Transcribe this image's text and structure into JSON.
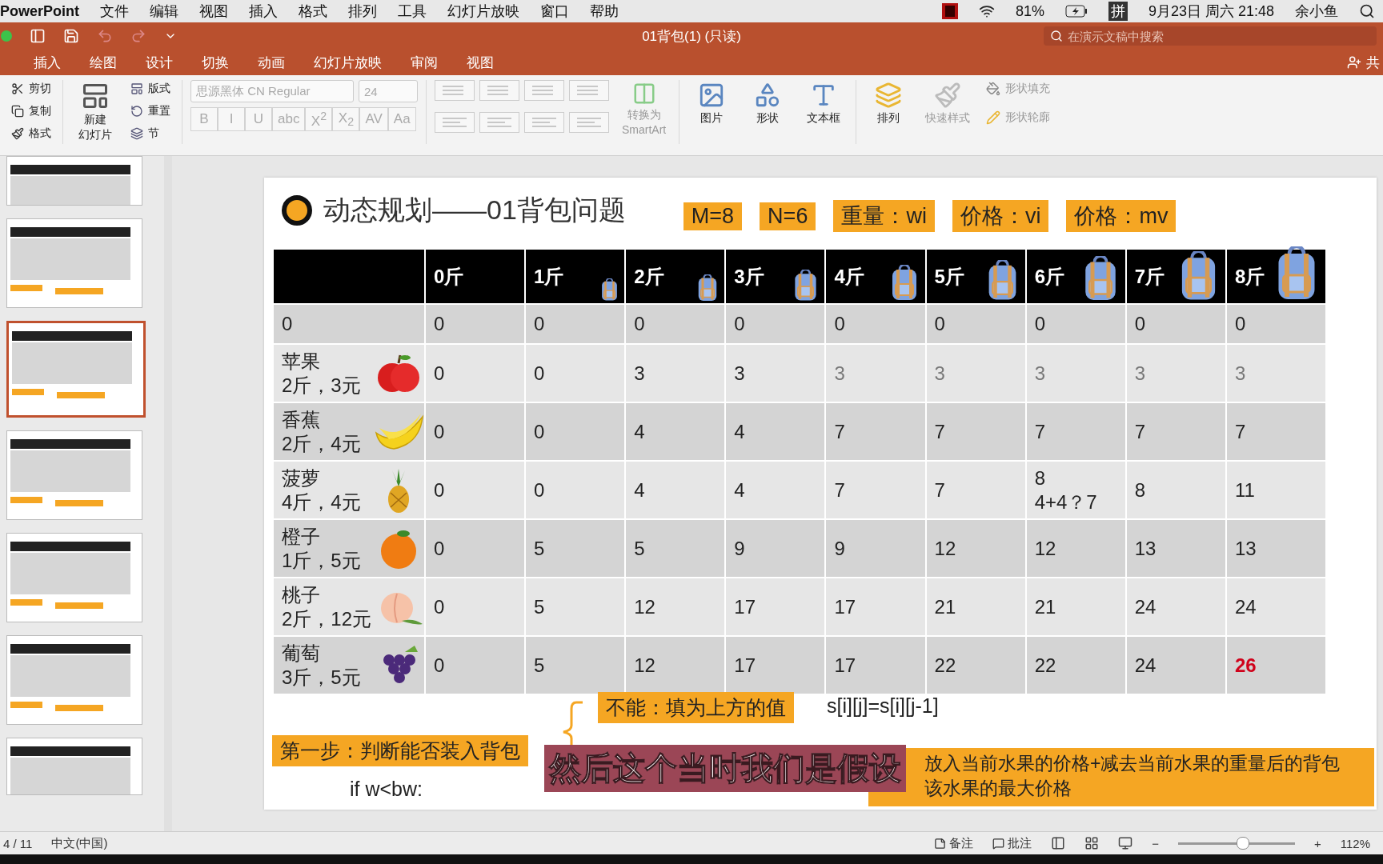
{
  "menu_bar": {
    "app": "PowerPoint",
    "items": [
      "文件",
      "编辑",
      "视图",
      "插入",
      "格式",
      "排列",
      "工具",
      "幻灯片放映",
      "窗口",
      "帮助"
    ],
    "battery": "81%",
    "input_method": "拼",
    "clock": "9月23日 周六 21:48",
    "user": "余小鱼"
  },
  "title_bar": {
    "title": "01背包(1) (只读)",
    "search": {
      "placeholder": "在演示文稿中搜索"
    },
    "share": "共"
  },
  "ribbon_tabs": [
    "插入",
    "绘图",
    "设计",
    "切换",
    "动画",
    "幻灯片放映",
    "审阅",
    "视图"
  ],
  "ribbon": {
    "clipboard": [
      "剪切",
      "复制",
      "格式"
    ],
    "new_slide": [
      "新建",
      "幻灯片"
    ],
    "slide_tools": [
      "版式",
      "重置",
      "节"
    ],
    "font_name": "思源黑体 CN Regular",
    "font_size": "24",
    "format_buttons": [
      "B",
      "I",
      "U",
      "abc",
      "X$^{2}$",
      "X$_{2}$",
      "AV",
      "Aa"
    ],
    "smartart": [
      "转换为",
      "SmartArt"
    ],
    "insert": [
      "图片",
      "形状",
      "文本框"
    ],
    "arrange": "排列",
    "quick_styles": "快速样式",
    "shape_fill": "形状填充",
    "shape_outline": "形状轮廓"
  },
  "slides": [
    {
      "selected": false
    },
    {
      "selected": false
    },
    {
      "selected": true
    },
    {
      "selected": false
    },
    {
      "selected": false
    },
    {
      "selected": false
    },
    {
      "selected": false
    }
  ],
  "slide": {
    "title": "动态规划——01背包问题",
    "tags": [
      "M=8",
      "N=6",
      "重量：wi",
      "价格：vi",
      "价格：mv"
    ],
    "table": {
      "columns": [
        "0斤",
        "1斤",
        "2斤",
        "3斤",
        "4斤",
        "5斤",
        "6斤",
        "7斤",
        "8斤"
      ],
      "rows": [
        {
          "label": [
            "0"
          ],
          "cells": [
            {
              "text": "0",
              "kind": "normal"
            },
            {
              "text": "0",
              "kind": "normal"
            },
            {
              "text": "0",
              "kind": "normal"
            },
            {
              "text": "0",
              "kind": "normal"
            },
            {
              "text": "0",
              "kind": "normal"
            },
            {
              "text": "0",
              "kind": "normal"
            },
            {
              "text": "0",
              "kind": "normal"
            },
            {
              "text": "0",
              "kind": "normal"
            },
            {
              "text": "0",
              "kind": "normal"
            }
          ]
        },
        {
          "label": [
            "苹果",
            "2斤，3元"
          ],
          "cells": [
            {
              "text": "0",
              "kind": "normal"
            },
            {
              "text": "0",
              "kind": "normal"
            },
            {
              "text": "3",
              "kind": "normal"
            },
            {
              "text": "3",
              "kind": "normal"
            },
            {
              "text": "3",
              "kind": "faded"
            },
            {
              "text": "3",
              "kind": "faded"
            },
            {
              "text": "3",
              "kind": "faded"
            },
            {
              "text": "3",
              "kind": "faded"
            },
            {
              "text": "3",
              "kind": "faded"
            }
          ]
        },
        {
          "label": [
            "香蕉",
            "2斤，4元"
          ],
          "cells": [
            {
              "text": "0",
              "kind": "normal"
            },
            {
              "text": "0",
              "kind": "normal"
            },
            {
              "text": "4",
              "kind": "normal"
            },
            {
              "text": "4",
              "kind": "normal"
            },
            {
              "text": "7",
              "kind": "normal"
            },
            {
              "text": "7",
              "kind": "normal"
            },
            {
              "text": "7",
              "kind": "normal"
            },
            {
              "text": "7",
              "kind": "normal"
            },
            {
              "text": "7",
              "kind": "normal"
            }
          ]
        },
        {
          "label": [
            "菠萝",
            "4斤，4元"
          ],
          "cells": [
            {
              "text": "0",
              "kind": "normal"
            },
            {
              "text": "0",
              "kind": "normal"
            },
            {
              "text": "4",
              "kind": "normal"
            },
            {
              "text": "4",
              "kind": "normal"
            },
            {
              "text": "7",
              "kind": "normal"
            },
            {
              "text": "7",
              "kind": "normal"
            },
            {
              "text": "8",
              "note": "4+4？7",
              "kind": "normal"
            },
            {
              "text": "8",
              "kind": "normal"
            },
            {
              "text": "11",
              "kind": "normal"
            }
          ]
        },
        {
          "label": [
            "橙子",
            "1斤，5元"
          ],
          "cells": [
            {
              "text": "0",
              "kind": "normal"
            },
            {
              "text": "5",
              "kind": "normal"
            },
            {
              "text": "5",
              "kind": "normal"
            },
            {
              "text": "9",
              "kind": "normal"
            },
            {
              "text": "9",
              "kind": "normal"
            },
            {
              "text": "12",
              "kind": "normal"
            },
            {
              "text": "12",
              "kind": "normal"
            },
            {
              "text": "13",
              "kind": "normal"
            },
            {
              "text": "13",
              "kind": "normal"
            }
          ]
        },
        {
          "label": [
            "桃子",
            "2斤，12元"
          ],
          "cells": [
            {
              "text": "0",
              "kind": "normal"
            },
            {
              "text": "5",
              "kind": "normal"
            },
            {
              "text": "12",
              "kind": "normal"
            },
            {
              "text": "17",
              "kind": "normal"
            },
            {
              "text": "17",
              "kind": "normal"
            },
            {
              "text": "21",
              "kind": "normal"
            },
            {
              "text": "21",
              "kind": "normal"
            },
            {
              "text": "24",
              "kind": "normal"
            },
            {
              "text": "24",
              "kind": "normal"
            }
          ]
        },
        {
          "label": [
            "葡萄",
            "3斤，5元"
          ],
          "cells": [
            {
              "text": "0",
              "kind": "normal"
            },
            {
              "text": "5",
              "kind": "normal"
            },
            {
              "text": "12",
              "kind": "normal"
            },
            {
              "text": "17",
              "kind": "normal"
            },
            {
              "text": "17",
              "kind": "normal"
            },
            {
              "text": "22",
              "kind": "normal"
            },
            {
              "text": "22",
              "kind": "normal"
            },
            {
              "text": "24",
              "kind": "normal"
            },
            {
              "text": "26",
              "kind": "red"
            }
          ]
        }
      ]
    },
    "notes": {
      "cannot": "不能：填为上方的值",
      "formula": "s[i][j]=s[i][j-1]",
      "step": "第一步：判断能否装入背包",
      "condition": "if w<bw:",
      "put_in": [
        "放入当前水果的价格+减去当前水果的重量后的背包",
        "该水果的最大价格"
      ]
    }
  },
  "subtitle": "然后这个当时我们是假设",
  "status_bar": {
    "slide": "4 / 11",
    "language": "中文(中国)",
    "notes": "备注",
    "comments": "批注",
    "zoom_out": "−",
    "zoom_slider": {
      "level": 0.55
    },
    "zoom_in": "+",
    "zoom": "112%"
  }
}
